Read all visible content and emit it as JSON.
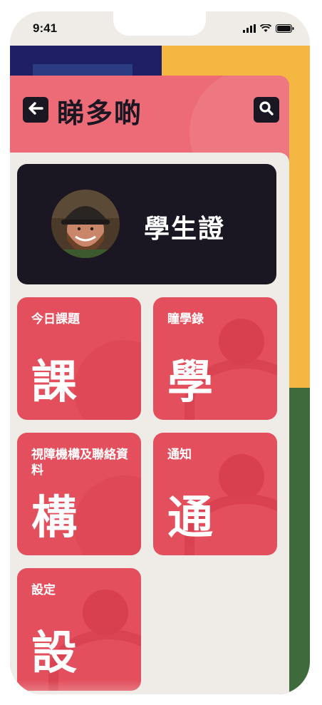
{
  "status_bar": {
    "time": "9:41"
  },
  "header": {
    "title": "睇多啲"
  },
  "id_card": {
    "label": "學生證"
  },
  "tiles": [
    {
      "small": "今日課題",
      "big": "課"
    },
    {
      "small": "瞳學錄",
      "big": "學"
    },
    {
      "small": "視障機構及聯絡資料",
      "big": "構"
    },
    {
      "small": "通知",
      "big": "通"
    },
    {
      "small": "設定",
      "big": "設"
    }
  ],
  "colors": {
    "header_bg": "#ec6b77",
    "tile_bg": "#e34f5d",
    "card_bg": "#1a1722",
    "content_bg": "#efece7"
  }
}
